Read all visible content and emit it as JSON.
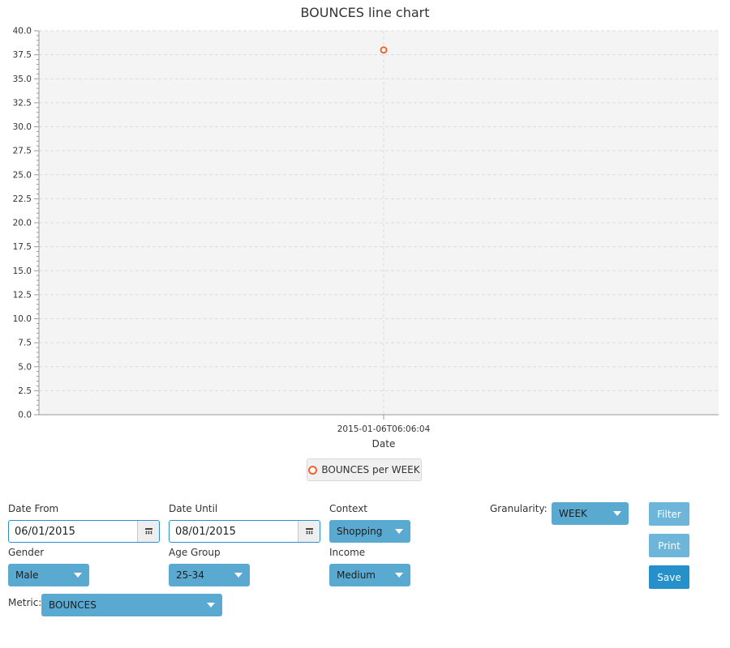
{
  "chart_data": {
    "type": "line",
    "title": "BOUNCES line chart",
    "xlabel": "Date",
    "ylabel": "",
    "categories": [
      "2015-01-06T06:06:04"
    ],
    "series": [
      {
        "name": "BOUNCES per WEEK",
        "values": [
          38
        ],
        "color": "#f3622d"
      }
    ],
    "ylim": [
      0,
      40
    ],
    "y_ticks": [
      "0.0",
      "2.5",
      "5.0",
      "7.5",
      "10.0",
      "12.5",
      "15.0",
      "17.5",
      "20.0",
      "22.5",
      "25.0",
      "27.5",
      "30.0",
      "32.5",
      "35.0",
      "37.5",
      "40.0"
    ],
    "grid": true,
    "legend": "bottom-center"
  },
  "legend": {
    "label": "BOUNCES per WEEK"
  },
  "filters": {
    "date_from": {
      "label": "Date From",
      "value": "06/01/2015"
    },
    "date_until": {
      "label": "Date Until",
      "value": "08/01/2015"
    },
    "context": {
      "label": "Context",
      "value": "Shopping"
    },
    "granularity": {
      "label": "Granularity:",
      "value": "WEEK"
    },
    "gender": {
      "label": "Gender",
      "value": "Male"
    },
    "age_group": {
      "label": "Age Group",
      "value": "25-34"
    },
    "income": {
      "label": "Income",
      "value": "Medium"
    },
    "metric": {
      "label": "Metric:",
      "value": "BOUNCES"
    }
  },
  "buttons": {
    "filter": "Filter",
    "print": "Print",
    "save": "Save"
  },
  "icons": {
    "calendar": "calendar-icon",
    "dropdown": "chevron-down-icon"
  },
  "colors": {
    "accent": "#5aa9d0",
    "primary_button": "#2590c9",
    "series": "#f3622d"
  }
}
